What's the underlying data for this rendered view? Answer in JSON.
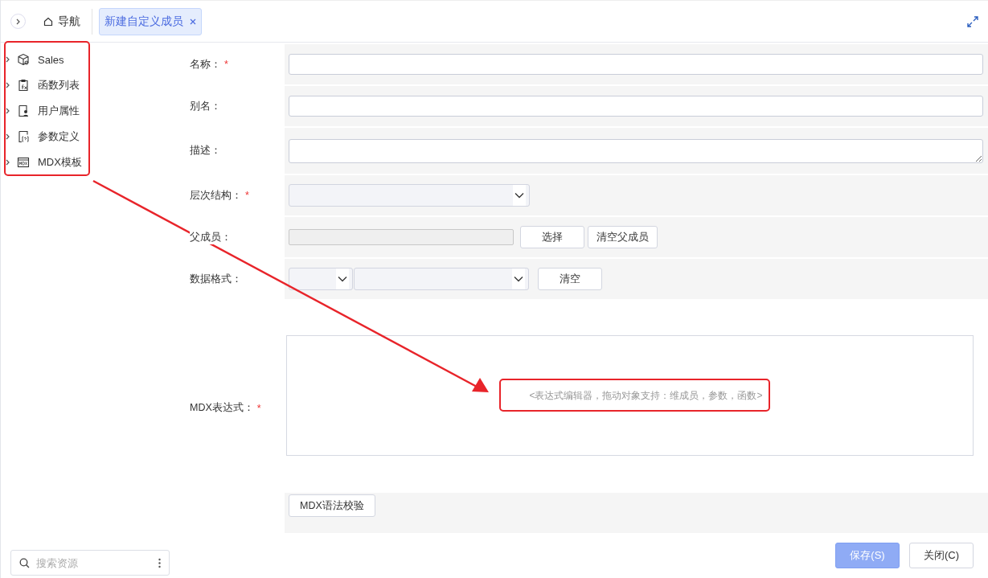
{
  "nav": {
    "label": "导航"
  },
  "tabs": [
    {
      "label": "新建自定义成员",
      "selected": true
    }
  ],
  "tree": [
    {
      "label": "Sales",
      "kind": "cube"
    },
    {
      "label": "函数列表",
      "kind": "function"
    },
    {
      "label": "用户属性",
      "kind": "user"
    },
    {
      "label": "参数定义",
      "kind": "param"
    },
    {
      "label": "MDX模板",
      "kind": "template"
    }
  ],
  "search": {
    "placeholder": "搜索资源"
  },
  "form": {
    "fields": [
      {
        "label": "名称：",
        "required_mark": "*",
        "kind": "text"
      },
      {
        "label": "别名：",
        "kind": "text"
      },
      {
        "label": "描述：",
        "kind": "textarea"
      },
      {
        "label": "层次结构：",
        "required_mark": "*",
        "kind": "select"
      },
      {
        "label": "父成员：",
        "kind": "picker",
        "buttons": [
          "选择",
          "清空父成员"
        ]
      },
      {
        "label": "数据格式：",
        "kind": "format",
        "buttons": [
          "清空"
        ]
      }
    ],
    "mdx": {
      "label": "MDX表达式：",
      "required_mark": "*",
      "placeholder": "<表达式编辑器，拖动对象支持：维成员，参数，函数>",
      "check_button": "MDX语法校验"
    }
  },
  "footer": {
    "buttons": [
      {
        "label": "保存(S)",
        "disabled": true
      },
      {
        "label": "关闭(C)",
        "disabled": false
      }
    ]
  }
}
